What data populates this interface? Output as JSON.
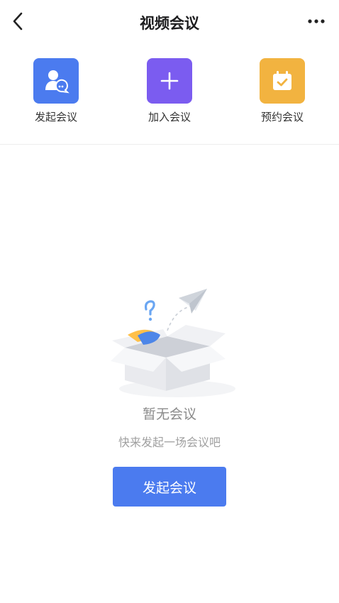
{
  "header": {
    "title": "视频会议"
  },
  "actions": [
    {
      "label": "发起会议",
      "icon": "start-meeting-icon",
      "color": "#4B7BEF"
    },
    {
      "label": "加入会议",
      "icon": "plus-icon",
      "color": "#7B5CF0"
    },
    {
      "label": "预约会议",
      "icon": "calendar-check-icon",
      "color": "#F2B340"
    }
  ],
  "empty_state": {
    "title": "暂无会议",
    "hint": "快来发起一场会议吧",
    "button_label": "发起会议",
    "button_color": "#4B7BEF"
  }
}
